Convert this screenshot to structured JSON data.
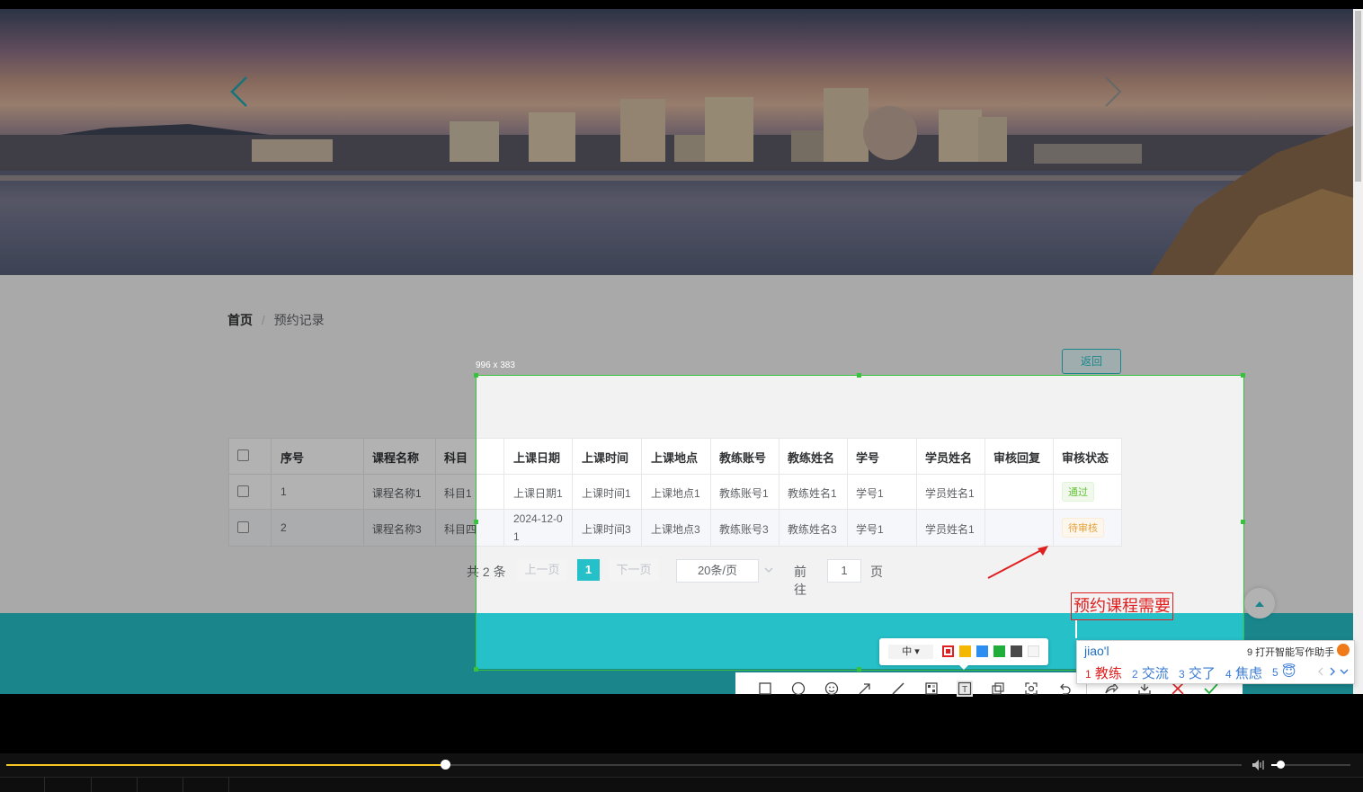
{
  "carousel": {
    "prev_icon": "chevron-left-icon",
    "next_icon": "chevron-right-icon"
  },
  "breadcrumb": {
    "home": "首页",
    "separator": "/",
    "current": "预约记录"
  },
  "back_button": "返回",
  "table": {
    "headers": [
      "序号",
      "课程名称",
      "科目",
      "上课日期",
      "上课时间",
      "上课地点",
      "教练账号",
      "教练姓名",
      "学号",
      "学员姓名",
      "审核回复",
      "审核状态"
    ],
    "rows": [
      [
        "1",
        "课程名称1",
        "科目1",
        "上课日期1",
        "上课时间1",
        "上课地点1",
        "教练账号1",
        "教练姓名1",
        "学号1",
        "学员姓名1",
        "",
        "通过"
      ],
      [
        "2",
        "课程名称3",
        "科目四",
        "2024-12-0",
        "上课时间3",
        "上课地点3",
        "教练账号3",
        "教练姓名3",
        "学号1",
        "学员姓名1",
        "",
        "待审核"
      ]
    ],
    "row2_date_line2": "1"
  },
  "pagination": {
    "total": "共 2 条",
    "prev": "上一页",
    "current_page": "1",
    "next": "下一页",
    "page_size": "20条/页",
    "goto_label": "前往",
    "goto_value": "1",
    "page_unit": "页"
  },
  "screenshot_overlay": {
    "size_label": "996 x 383",
    "annotation_text": "预约课程需要",
    "font_size_menu": "中 ▾",
    "colors": [
      "#e02020",
      "#f5b800",
      "#2b8ef0",
      "#1fae3a",
      "#4a4a4a",
      "#f5f5f5"
    ],
    "tools": [
      "rectangle-icon",
      "ellipse-icon",
      "emoji-icon",
      "arrow-icon",
      "line-icon",
      "mosaic-icon",
      "text-icon",
      "pin-icon",
      "ocr-icon",
      "undo-icon",
      "share-icon",
      "save-icon",
      "cancel-icon",
      "confirm-icon"
    ]
  },
  "ime": {
    "input": "jiao'l",
    "assistant": "9 打开智能写作助手",
    "candidates": [
      {
        "num": "1",
        "word": "教练"
      },
      {
        "num": "2",
        "word": "交流"
      },
      {
        "num": "3",
        "word": "交了"
      },
      {
        "num": "4",
        "word": "焦虑"
      },
      {
        "num": "5",
        "word": "😇"
      }
    ]
  },
  "player": {
    "progress": 0.355,
    "volume": 0.11
  },
  "colors": {
    "teal": "#26c0c9",
    "footer_dim": "#1e7f86",
    "success": "#67c23a",
    "warning": "#e6a23c",
    "selection_green": "#36c23a",
    "annotation_red": "#e02020"
  }
}
